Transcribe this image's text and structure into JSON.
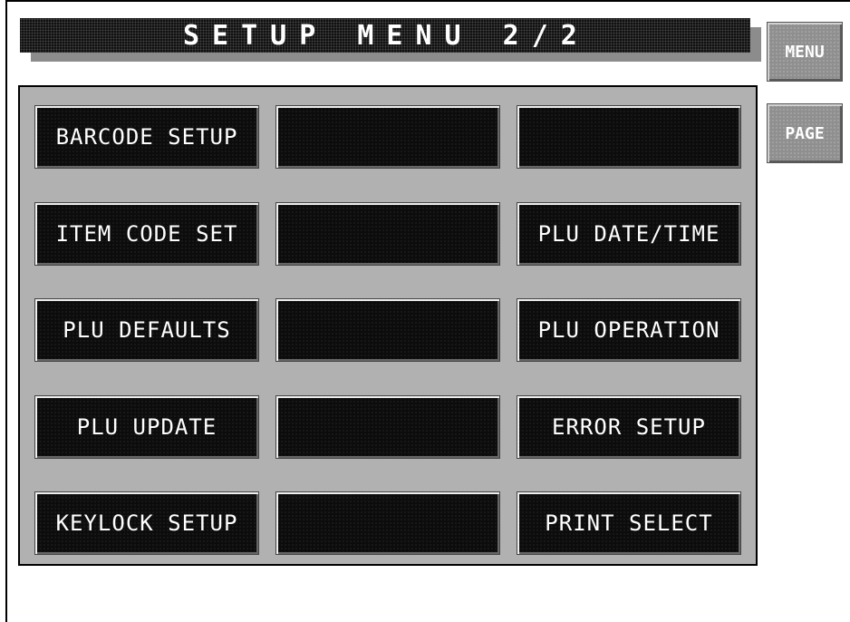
{
  "title": "SETUP MENU 2/2",
  "side_buttons": {
    "menu_label": "MENU",
    "page_label": "PAGE"
  },
  "grid": {
    "col1": [
      "BARCODE SETUP",
      "ITEM CODE SET",
      "PLU DEFAULTS",
      "PLU UPDATE",
      "KEYLOCK SETUP"
    ],
    "col2": [
      "",
      "",
      "",
      "",
      ""
    ],
    "col3": [
      "",
      "PLU DATE/TIME",
      "PLU OPERATION",
      "ERROR SETUP",
      "PRINT SELECT"
    ]
  },
  "colors": {
    "panel_bg": "#b1b1b1",
    "button_bg": "#0c0c0c",
    "side_button_bg": "#8f8f8f",
    "text": "#ffffff"
  }
}
